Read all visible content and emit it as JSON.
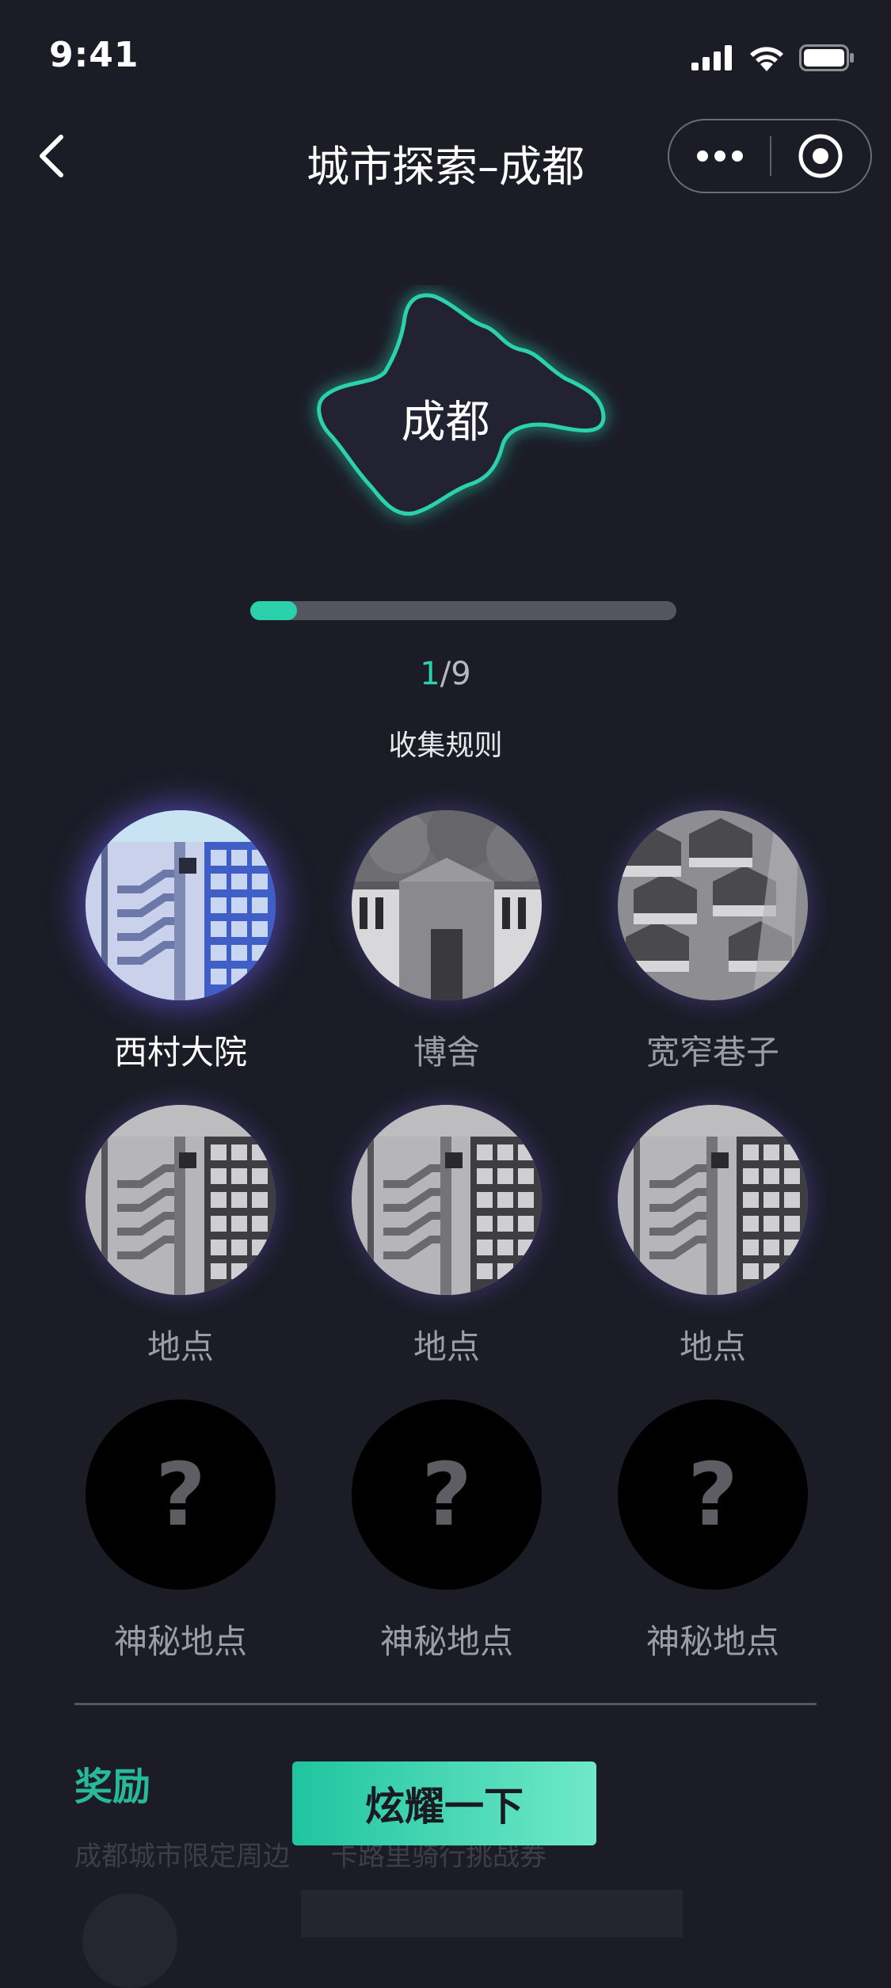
{
  "status_bar": {
    "time": "9:41"
  },
  "nav": {
    "title": "城市探索–成都"
  },
  "city": {
    "name": "成都",
    "accent": "#2bd1ac"
  },
  "progress": {
    "current": "1",
    "separator": "/",
    "total": "9",
    "fraction": 0.11
  },
  "rules_link": "收集规则",
  "spots": [
    {
      "name": "西村大院",
      "state": "active"
    },
    {
      "name": "博舍",
      "state": "visited"
    },
    {
      "name": "宽窄巷子",
      "state": "visited"
    },
    {
      "name": "地点",
      "state": "visited"
    },
    {
      "name": "地点",
      "state": "visited"
    },
    {
      "name": "地点",
      "state": "visited"
    },
    {
      "name": "神秘地点",
      "state": "locked",
      "symbol": "?"
    },
    {
      "name": "神秘地点",
      "state": "locked",
      "symbol": "?"
    },
    {
      "name": "神秘地点",
      "state": "locked",
      "symbol": "?"
    }
  ],
  "rewards": {
    "title": "奖励",
    "items": [
      "成都城市限定周边",
      "卡路里骑行挑战券"
    ]
  },
  "cta": {
    "label": "炫耀一下"
  }
}
